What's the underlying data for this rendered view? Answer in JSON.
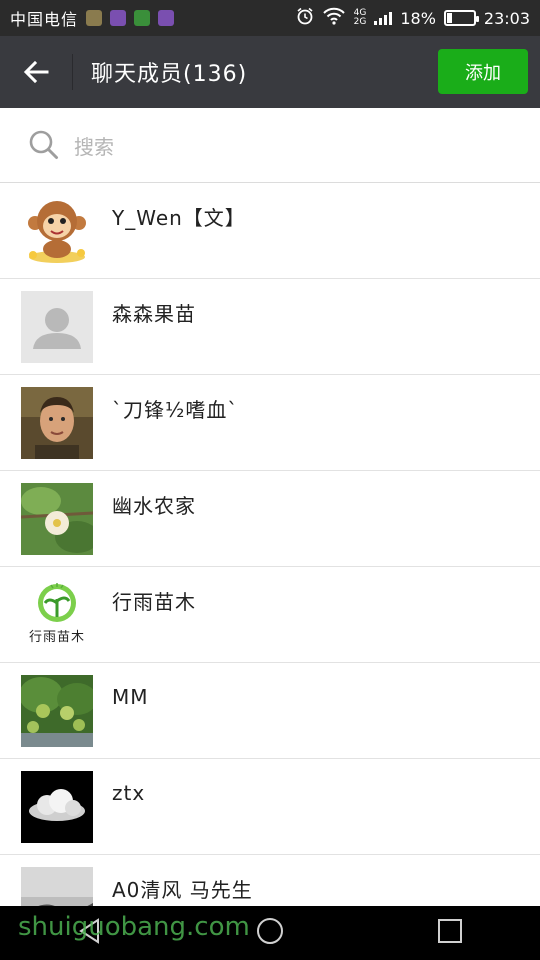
{
  "status_bar": {
    "carrier": "中国电信",
    "network_top": "4G",
    "network_bottom": "2G",
    "battery_percent": "18%",
    "battery_level": 0.18,
    "time": "23:03",
    "notif_colors": [
      "#8a7b4e",
      "#7a4fb0",
      "#3a8f3a",
      "#7a4fb0"
    ]
  },
  "header": {
    "title": "聊天成员(136)",
    "add_label": "添加",
    "background": "#393a3f",
    "accent": "#1aad19"
  },
  "search": {
    "placeholder": "搜索"
  },
  "members": [
    {
      "name": "Y_Wen【文】",
      "avatar": "monkey-cartoon"
    },
    {
      "name": "森森果苗",
      "avatar": "default-person"
    },
    {
      "name": "`刀锋½嗜血`",
      "avatar": "man-photo"
    },
    {
      "name": "幽水农家",
      "avatar": "kiwi-flower"
    },
    {
      "name": "行雨苗木",
      "avatar": "green-logo",
      "avatar_text": "行雨苗木"
    },
    {
      "name": "MM",
      "avatar": "fruit-tree"
    },
    {
      "name": "ztx",
      "avatar": "cloud"
    },
    {
      "name": "A0清风 马先生",
      "avatar": "silhouette"
    }
  ],
  "watermark": "shuiguobang.com"
}
